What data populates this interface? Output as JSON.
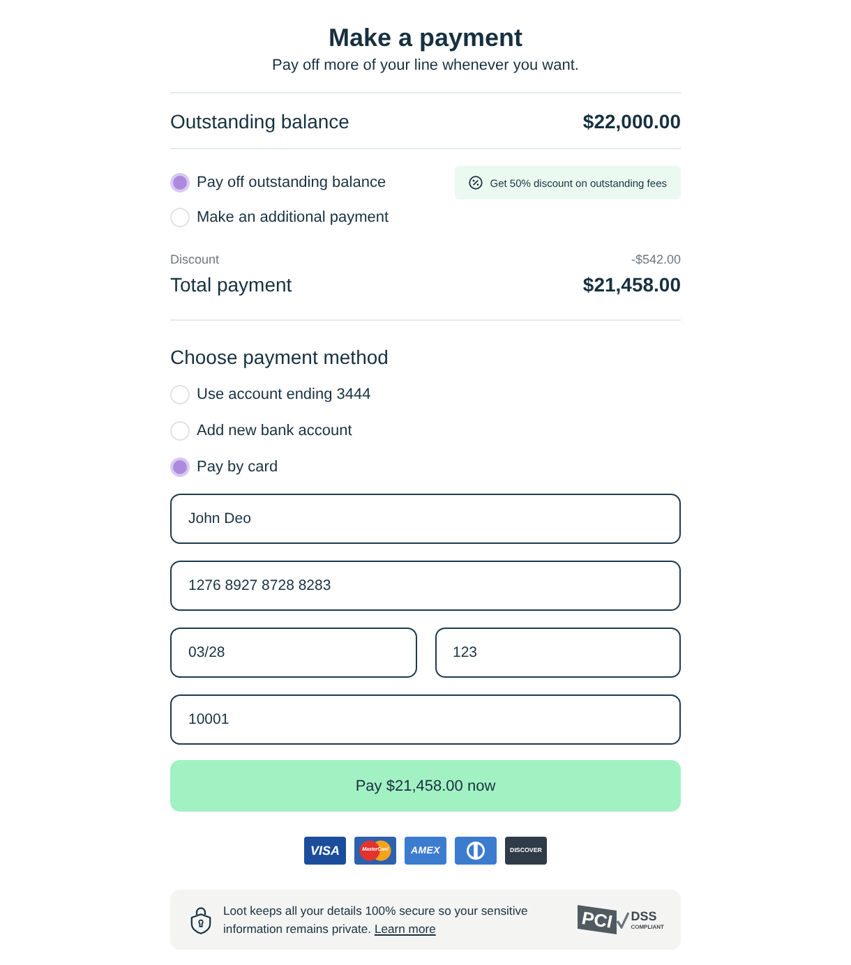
{
  "header": {
    "title": "Make a payment",
    "subtitle": "Pay off more of your line whenever you want."
  },
  "balance": {
    "label": "Outstanding balance",
    "amount": "$22,000.00"
  },
  "payment_options": [
    {
      "label": "Pay off outstanding balance",
      "selected": true
    },
    {
      "label": "Make an additional payment",
      "selected": false
    }
  ],
  "promo_badge": {
    "text": "Get 50% discount on outstanding fees"
  },
  "summary": {
    "discount_label": "Discount",
    "discount_amount": "-$542.00",
    "total_label": "Total payment",
    "total_amount": "$21,458.00"
  },
  "payment_method": {
    "heading": "Choose payment method",
    "options": [
      {
        "label": "Use account ending 3444",
        "selected": false
      },
      {
        "label": "Add new bank account",
        "selected": false
      },
      {
        "label": "Pay by card",
        "selected": true
      }
    ]
  },
  "card_form": {
    "rows": [
      {
        "fields": [
          {
            "value": "John Deo"
          }
        ]
      },
      {
        "fields": [
          {
            "value": "1276 8927 8728 8283"
          }
        ]
      },
      {
        "fields": [
          {
            "value": "03/28"
          },
          {
            "value": "123"
          }
        ]
      },
      {
        "fields": [
          {
            "value": "10001"
          }
        ]
      }
    ]
  },
  "pay_button": {
    "label": "Pay $21,458.00 now"
  },
  "card_logos": [
    {
      "kind": "visa",
      "text": "VISA"
    },
    {
      "kind": "mastercard",
      "text": "MasterCard"
    },
    {
      "kind": "amex",
      "text": "AMEX"
    },
    {
      "kind": "diners"
    },
    {
      "kind": "discover",
      "text": "DISCOVER"
    }
  ],
  "security_note": {
    "text": "Loot keeps all your details 100% secure so your sensitive information remains private.",
    "link": "Learn more",
    "badge": {
      "mark": "PCI",
      "label": "DSS",
      "sublabel": "COMPLIANT"
    }
  }
}
